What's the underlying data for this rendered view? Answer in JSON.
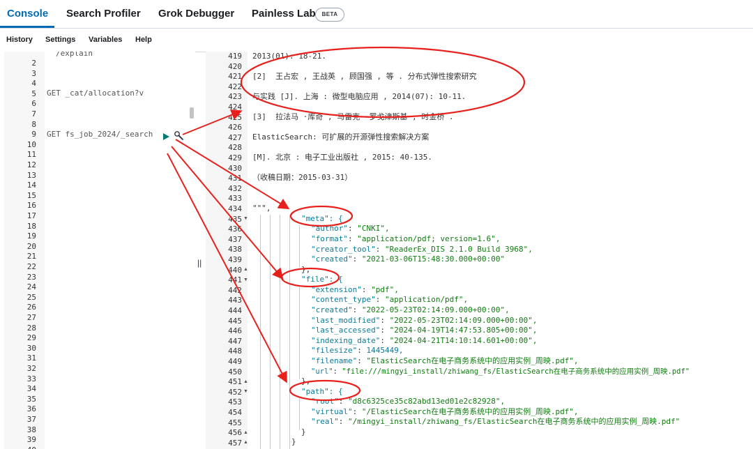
{
  "tabs": [
    {
      "label": "Console",
      "active": true
    },
    {
      "label": "Search Profiler"
    },
    {
      "label": "Grok Debugger"
    },
    {
      "label": "Painless Lab",
      "badge": "BETA"
    }
  ],
  "menu": [
    "History",
    "Settings",
    "Variables",
    "Help"
  ],
  "left_editor": {
    "lines": [
      "2",
      "3",
      "4",
      "5",
      "6",
      "7",
      "8",
      "9",
      "10",
      "11",
      "12",
      "13",
      "14",
      "15",
      "16",
      "17",
      "18",
      "19",
      "20",
      "21",
      "22",
      "23",
      "24",
      "25",
      "26",
      "27",
      "28",
      "29",
      "30",
      "31",
      "32",
      "33",
      "34",
      "35",
      "36",
      "37",
      "38",
      "39",
      "40"
    ],
    "partial_top": "/explain",
    "req_allocation": "GET _cat/allocation?v",
    "req_search": "GET fs_job_2024/_search"
  },
  "right_editor": {
    "line_numbers": [
      "419",
      "420",
      "421",
      "422",
      "423",
      "424",
      "425",
      "426",
      "427",
      "428",
      "429",
      "430",
      "431",
      "432",
      "433",
      "434",
      "435",
      "436",
      "437",
      "438",
      "439",
      "440",
      "441",
      "442",
      "443",
      "444",
      "445",
      "446",
      "447",
      "448",
      "449",
      "450",
      "451",
      "452",
      "453",
      "454",
      "455",
      "456",
      "457"
    ],
    "text": {
      "l419": "2013(01): 18-21.",
      "l421": "[2]  王占宏 , 王战英 , 顾国强 , 等 . 分布式弹性搜索研究",
      "l423": "与实践 [J]. 上海 : 微型电脑应用 , 2014(07): 10-11.",
      "l425": "[3]  拉法马 ·库奇 , 马雷克 ·罗戈津斯基 , 时金桥 .",
      "l427": "ElasticSearch: 可扩展的开源弹性搜索解决方案",
      "l429": "[M]. 北京 : 电子工业出版社 , 2015: 40-135.",
      "l431": "（收稿日期：2015-03-31）",
      "l434": "\"\"\","
    },
    "meta": {
      "key": "\"meta\": {",
      "author_k": "\"author\"",
      "author_v": "\"CNKI\",",
      "format_k": "\"format\"",
      "format_v": "\"application/pdf; version=1.6\",",
      "creator_k": "\"creator_tool\"",
      "creator_v": "\"ReaderEx_DIS 2.1.0 Build 3968\",",
      "created_k": "\"created\"",
      "created_v": "\"2021-03-06T15:48:30.000+00:00\""
    },
    "file": {
      "key": "\"file\": {",
      "ext_k": "\"extension\"",
      "ext_v": "\"pdf\",",
      "ctype_k": "\"content_type\"",
      "ctype_v": "\"application/pdf\",",
      "created_k": "\"created\"",
      "created_v": "\"2022-05-23T02:14:09.000+00:00\",",
      "lastmod_k": "\"last_modified\"",
      "lastmod_v": "\"2022-05-23T02:14:09.000+00:00\",",
      "lastacc_k": "\"last_accessed\"",
      "lastacc_v": "\"2024-04-19T14:47:53.805+00:00\",",
      "idx_k": "\"indexing_date\"",
      "idx_v": "\"2024-04-21T14:10:14.601+00:00\",",
      "size_k": "\"filesize\"",
      "size_v": "1445449,",
      "name_k": "\"filename\"",
      "name_v": "\"ElasticSearch在电子商务系统中的应用实例_周映.pdf\",",
      "url_k": "\"url\"",
      "url_v": "\"file:///mingyi_install/zhiwang_fs/ElasticSearch在电子商务系统中的应用实例_周映.pdf\""
    },
    "path": {
      "key": "\"path\": {",
      "root_k": "\"root\"",
      "root_v": "\"d8c6325ce35c82abd13ed01e2c82928\",",
      "virt_k": "\"virtual\"",
      "virt_v": "\"/ElasticSearch在电子商务系统中的应用实例_周映.pdf\",",
      "real_k": "\"real\"",
      "real_v": "\"/mingyi_install/zhiwang_fs/ElasticSearch在电子商务系统中的应用实例_周映.pdf\""
    }
  },
  "colors": {
    "accent": "#006bb8",
    "annotation": "#e8201c",
    "run": "#017d73"
  }
}
